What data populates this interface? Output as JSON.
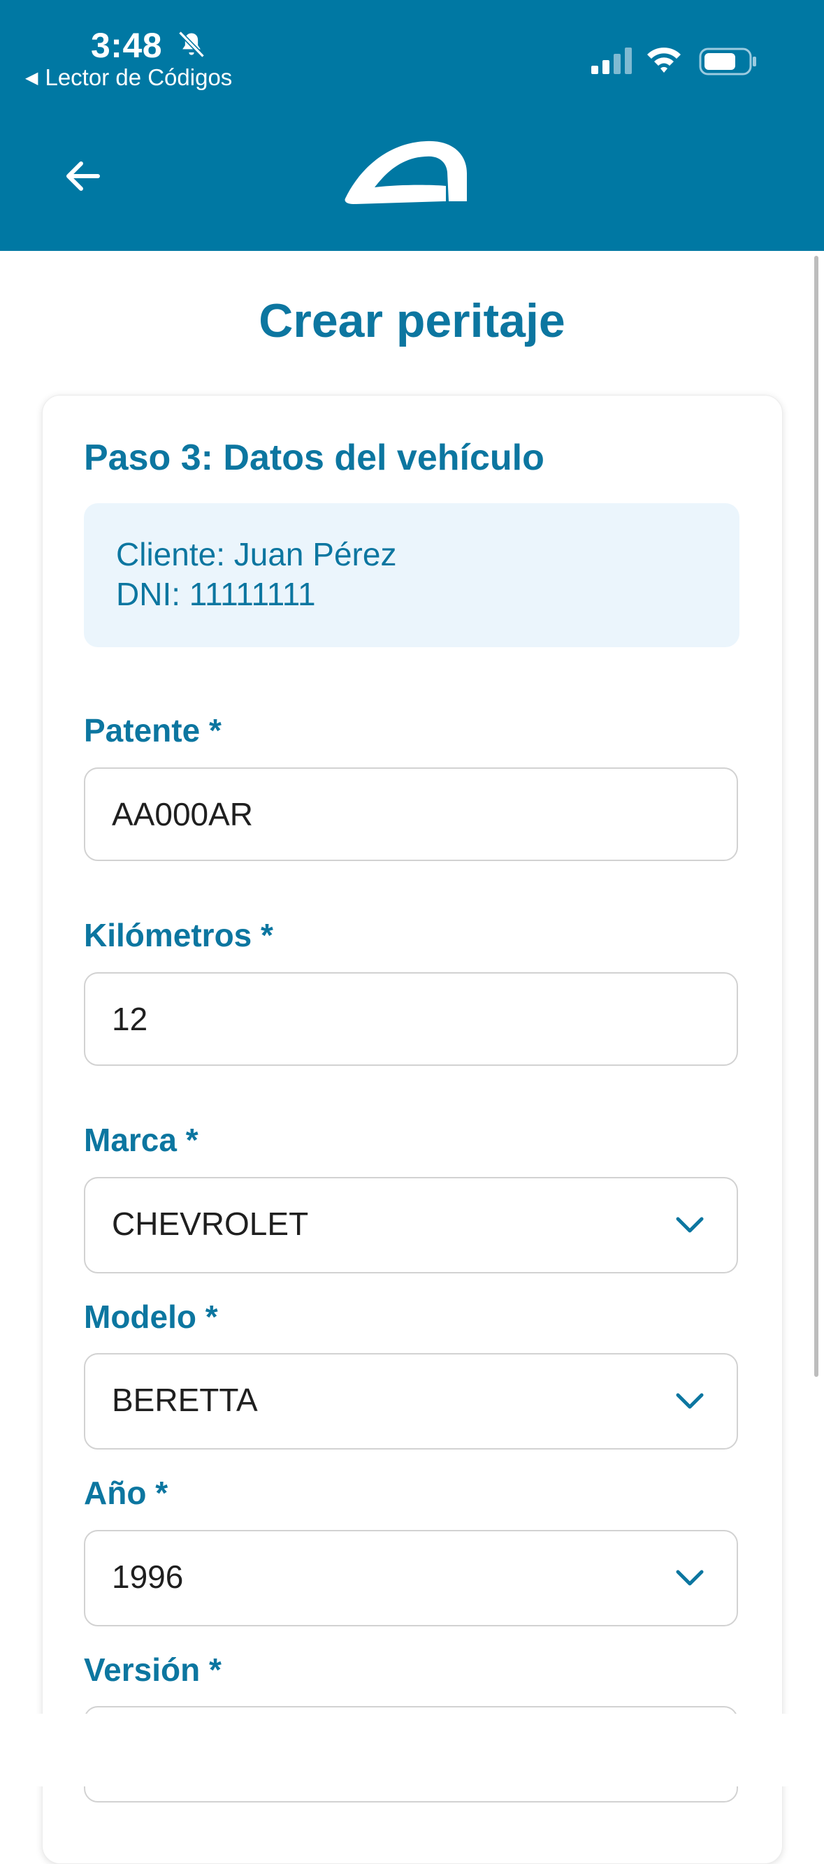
{
  "status": {
    "time": "3:48",
    "back_app_label": "Lector de Códigos"
  },
  "header": {
    "back_icon": "arrow-left-icon",
    "logo_icon": "car-roof-logo"
  },
  "page": {
    "title": "Crear peritaje"
  },
  "step": {
    "title": "Paso 3: Datos del vehículo",
    "client_line": "Cliente: Juan Pérez",
    "dni_line": "DNI: 11111111"
  },
  "fields": {
    "patente": {
      "label": "Patente *",
      "value": "AA000AR"
    },
    "kilometros": {
      "label": "Kilómetros *",
      "value": "12"
    },
    "marca": {
      "label": "Marca *",
      "value": "CHEVROLET"
    },
    "modelo": {
      "label": "Modelo *",
      "value": "BERETTA"
    },
    "anio": {
      "label": "Año *",
      "value": "1996"
    },
    "version": {
      "label": "Versión *",
      "value": ""
    }
  },
  "colors": {
    "primary": "#0078a3",
    "accent_text": "#0c76a0",
    "info_bg": "#ebf5fc",
    "border": "#d2d2d2"
  }
}
